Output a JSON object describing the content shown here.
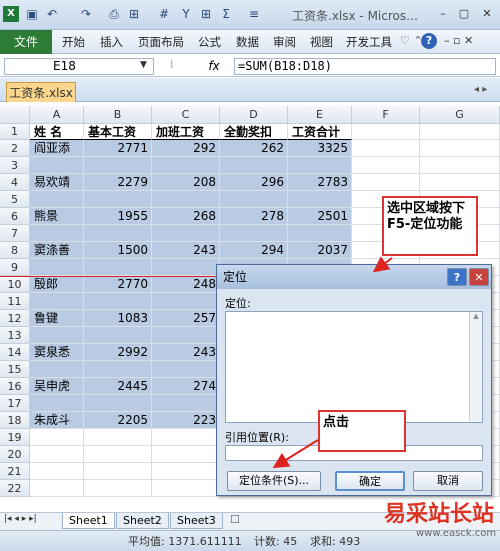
{
  "window": {
    "title": "工资条.xlsx - Micros…",
    "min": "–",
    "max": "▢",
    "close": "✕"
  },
  "ribbon": {
    "file": "文件",
    "tabs": [
      "开始",
      "插入",
      "页面布局",
      "公式",
      "数据",
      "审阅",
      "视图",
      "开发工具"
    ]
  },
  "formula_bar": {
    "cell_ref": "E18",
    "fx": "fx",
    "formula": "=SUM(B18:D18)"
  },
  "workbook_tab": "工资条.xlsx",
  "columns": [
    "A",
    "B",
    "C",
    "D",
    "E",
    "F",
    "G"
  ],
  "headers": [
    "姓 名",
    "基本工资",
    "加班工资",
    "全勤奖扣",
    "工资合计"
  ],
  "rows": [
    {
      "n": "1"
    },
    {
      "n": "2",
      "name": "阎亚添",
      "b": "2771",
      "c": "292",
      "d": "262",
      "e": "3325"
    },
    {
      "n": "3"
    },
    {
      "n": "4",
      "name": "易欢靖",
      "b": "2279",
      "c": "208",
      "d": "296",
      "e": "2783"
    },
    {
      "n": "5"
    },
    {
      "n": "6",
      "name": "熊景",
      "b": "1955",
      "c": "268",
      "d": "278",
      "e": "2501"
    },
    {
      "n": "7"
    },
    {
      "n": "8",
      "name": "窦涤善",
      "b": "1500",
      "c": "243",
      "d": "294",
      "e": "2037"
    },
    {
      "n": "9"
    },
    {
      "n": "10",
      "name": "殷郎",
      "b": "2770",
      "c": "248"
    },
    {
      "n": "11"
    },
    {
      "n": "12",
      "name": "鲁键",
      "b": "1083",
      "c": "257"
    },
    {
      "n": "13"
    },
    {
      "n": "14",
      "name": "窦泉悉",
      "b": "2992",
      "c": "243"
    },
    {
      "n": "15"
    },
    {
      "n": "16",
      "name": "吴申虎",
      "b": "2445",
      "c": "274"
    },
    {
      "n": "17"
    },
    {
      "n": "18",
      "name": "朱成斗",
      "b": "2205",
      "c": "223"
    },
    {
      "n": "19"
    },
    {
      "n": "20"
    },
    {
      "n": "21"
    },
    {
      "n": "22"
    }
  ],
  "dialog": {
    "title": "定位",
    "goto_label": "定位:",
    "ref_label": "引用位置(R):",
    "special_button": "定位条件(S)...",
    "ok_button": "确定",
    "cancel_button": "取消",
    "help": "?",
    "close": "✕"
  },
  "annotations": {
    "select_hint": "选中区域按下F5-定位功能",
    "click_hint": "点击"
  },
  "sheets": [
    "Sheet1",
    "Sheet2",
    "Sheet3"
  ],
  "status": {
    "average": "平均值: 1371.611111",
    "count": "计数: 45",
    "sum": "求和: 493"
  },
  "watermark": "易采站长站",
  "watermark_url": "www.easck.com"
}
